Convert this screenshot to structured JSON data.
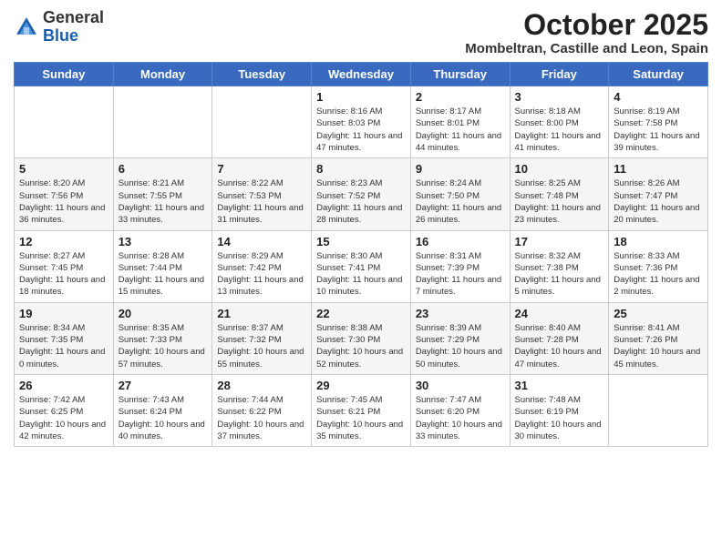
{
  "logo": {
    "general": "General",
    "blue": "Blue"
  },
  "header": {
    "month": "October 2025",
    "location": "Mombeltran, Castille and Leon, Spain"
  },
  "days_of_week": [
    "Sunday",
    "Monday",
    "Tuesday",
    "Wednesday",
    "Thursday",
    "Friday",
    "Saturday"
  ],
  "weeks": [
    [
      {
        "day": "",
        "sunrise": "",
        "sunset": "",
        "daylight": ""
      },
      {
        "day": "",
        "sunrise": "",
        "sunset": "",
        "daylight": ""
      },
      {
        "day": "",
        "sunrise": "",
        "sunset": "",
        "daylight": ""
      },
      {
        "day": "1",
        "sunrise": "Sunrise: 8:16 AM",
        "sunset": "Sunset: 8:03 PM",
        "daylight": "Daylight: 11 hours and 47 minutes."
      },
      {
        "day": "2",
        "sunrise": "Sunrise: 8:17 AM",
        "sunset": "Sunset: 8:01 PM",
        "daylight": "Daylight: 11 hours and 44 minutes."
      },
      {
        "day": "3",
        "sunrise": "Sunrise: 8:18 AM",
        "sunset": "Sunset: 8:00 PM",
        "daylight": "Daylight: 11 hours and 41 minutes."
      },
      {
        "day": "4",
        "sunrise": "Sunrise: 8:19 AM",
        "sunset": "Sunset: 7:58 PM",
        "daylight": "Daylight: 11 hours and 39 minutes."
      }
    ],
    [
      {
        "day": "5",
        "sunrise": "Sunrise: 8:20 AM",
        "sunset": "Sunset: 7:56 PM",
        "daylight": "Daylight: 11 hours and 36 minutes."
      },
      {
        "day": "6",
        "sunrise": "Sunrise: 8:21 AM",
        "sunset": "Sunset: 7:55 PM",
        "daylight": "Daylight: 11 hours and 33 minutes."
      },
      {
        "day": "7",
        "sunrise": "Sunrise: 8:22 AM",
        "sunset": "Sunset: 7:53 PM",
        "daylight": "Daylight: 11 hours and 31 minutes."
      },
      {
        "day": "8",
        "sunrise": "Sunrise: 8:23 AM",
        "sunset": "Sunset: 7:52 PM",
        "daylight": "Daylight: 11 hours and 28 minutes."
      },
      {
        "day": "9",
        "sunrise": "Sunrise: 8:24 AM",
        "sunset": "Sunset: 7:50 PM",
        "daylight": "Daylight: 11 hours and 26 minutes."
      },
      {
        "day": "10",
        "sunrise": "Sunrise: 8:25 AM",
        "sunset": "Sunset: 7:48 PM",
        "daylight": "Daylight: 11 hours and 23 minutes."
      },
      {
        "day": "11",
        "sunrise": "Sunrise: 8:26 AM",
        "sunset": "Sunset: 7:47 PM",
        "daylight": "Daylight: 11 hours and 20 minutes."
      }
    ],
    [
      {
        "day": "12",
        "sunrise": "Sunrise: 8:27 AM",
        "sunset": "Sunset: 7:45 PM",
        "daylight": "Daylight: 11 hours and 18 minutes."
      },
      {
        "day": "13",
        "sunrise": "Sunrise: 8:28 AM",
        "sunset": "Sunset: 7:44 PM",
        "daylight": "Daylight: 11 hours and 15 minutes."
      },
      {
        "day": "14",
        "sunrise": "Sunrise: 8:29 AM",
        "sunset": "Sunset: 7:42 PM",
        "daylight": "Daylight: 11 hours and 13 minutes."
      },
      {
        "day": "15",
        "sunrise": "Sunrise: 8:30 AM",
        "sunset": "Sunset: 7:41 PM",
        "daylight": "Daylight: 11 hours and 10 minutes."
      },
      {
        "day": "16",
        "sunrise": "Sunrise: 8:31 AM",
        "sunset": "Sunset: 7:39 PM",
        "daylight": "Daylight: 11 hours and 7 minutes."
      },
      {
        "day": "17",
        "sunrise": "Sunrise: 8:32 AM",
        "sunset": "Sunset: 7:38 PM",
        "daylight": "Daylight: 11 hours and 5 minutes."
      },
      {
        "day": "18",
        "sunrise": "Sunrise: 8:33 AM",
        "sunset": "Sunset: 7:36 PM",
        "daylight": "Daylight: 11 hours and 2 minutes."
      }
    ],
    [
      {
        "day": "19",
        "sunrise": "Sunrise: 8:34 AM",
        "sunset": "Sunset: 7:35 PM",
        "daylight": "Daylight: 11 hours and 0 minutes."
      },
      {
        "day": "20",
        "sunrise": "Sunrise: 8:35 AM",
        "sunset": "Sunset: 7:33 PM",
        "daylight": "Daylight: 10 hours and 57 minutes."
      },
      {
        "day": "21",
        "sunrise": "Sunrise: 8:37 AM",
        "sunset": "Sunset: 7:32 PM",
        "daylight": "Daylight: 10 hours and 55 minutes."
      },
      {
        "day": "22",
        "sunrise": "Sunrise: 8:38 AM",
        "sunset": "Sunset: 7:30 PM",
        "daylight": "Daylight: 10 hours and 52 minutes."
      },
      {
        "day": "23",
        "sunrise": "Sunrise: 8:39 AM",
        "sunset": "Sunset: 7:29 PM",
        "daylight": "Daylight: 10 hours and 50 minutes."
      },
      {
        "day": "24",
        "sunrise": "Sunrise: 8:40 AM",
        "sunset": "Sunset: 7:28 PM",
        "daylight": "Daylight: 10 hours and 47 minutes."
      },
      {
        "day": "25",
        "sunrise": "Sunrise: 8:41 AM",
        "sunset": "Sunset: 7:26 PM",
        "daylight": "Daylight: 10 hours and 45 minutes."
      }
    ],
    [
      {
        "day": "26",
        "sunrise": "Sunrise: 7:42 AM",
        "sunset": "Sunset: 6:25 PM",
        "daylight": "Daylight: 10 hours and 42 minutes."
      },
      {
        "day": "27",
        "sunrise": "Sunrise: 7:43 AM",
        "sunset": "Sunset: 6:24 PM",
        "daylight": "Daylight: 10 hours and 40 minutes."
      },
      {
        "day": "28",
        "sunrise": "Sunrise: 7:44 AM",
        "sunset": "Sunset: 6:22 PM",
        "daylight": "Daylight: 10 hours and 37 minutes."
      },
      {
        "day": "29",
        "sunrise": "Sunrise: 7:45 AM",
        "sunset": "Sunset: 6:21 PM",
        "daylight": "Daylight: 10 hours and 35 minutes."
      },
      {
        "day": "30",
        "sunrise": "Sunrise: 7:47 AM",
        "sunset": "Sunset: 6:20 PM",
        "daylight": "Daylight: 10 hours and 33 minutes."
      },
      {
        "day": "31",
        "sunrise": "Sunrise: 7:48 AM",
        "sunset": "Sunset: 6:19 PM",
        "daylight": "Daylight: 10 hours and 30 minutes."
      },
      {
        "day": "",
        "sunrise": "",
        "sunset": "",
        "daylight": ""
      }
    ]
  ]
}
